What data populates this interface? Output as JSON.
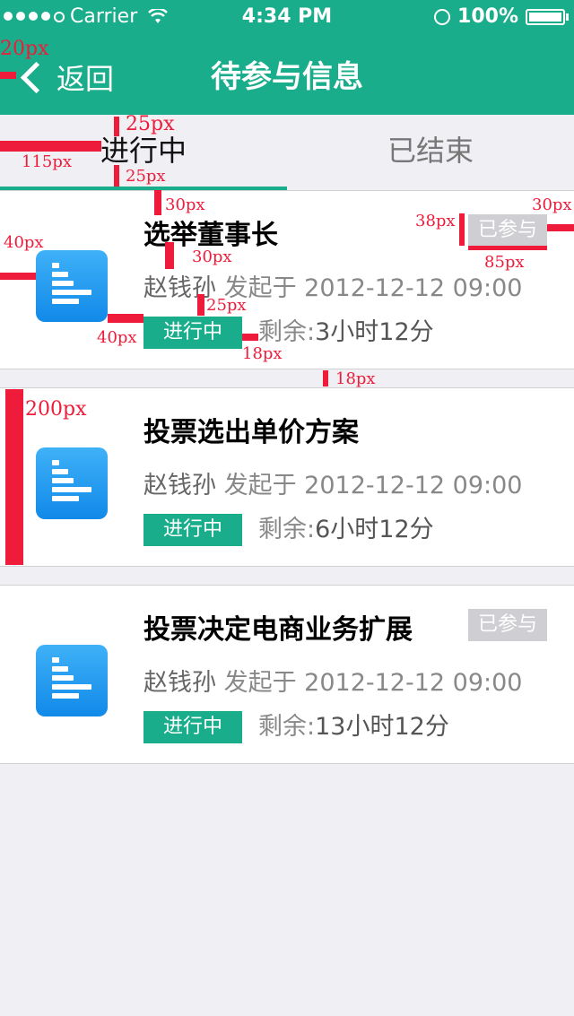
{
  "status": {
    "carrier": "Carrier",
    "time": "4:34 PM",
    "battery": "100%"
  },
  "nav": {
    "back_label": "返回",
    "title": "待参与信息"
  },
  "tabs": [
    {
      "label": "进行中"
    },
    {
      "label": "已结束"
    }
  ],
  "items": [
    {
      "title": "选举董事长",
      "author": "赵钱孙",
      "initiated": "发起于 2012-12-12  09:00",
      "status": "进行中",
      "remain_label": "剩余:",
      "remain_value": "3小时12分",
      "joined": "已参与"
    },
    {
      "title": "投票选出单价方案",
      "author": "赵钱孙",
      "initiated": "发起于 2012-12-12  09:00",
      "status": "进行中",
      "remain_label": "剩余:",
      "remain_value": "6小时12分",
      "joined": ""
    },
    {
      "title": "投票决定电商业务扩展",
      "author": "赵钱孙",
      "initiated": "发起于 2012-12-12  09:00",
      "status": "进行中",
      "remain_label": "剩余:",
      "remain_value": "13小时12分",
      "joined": "已参与"
    }
  ],
  "annotations": {
    "a20": "20px",
    "a25top": "25px",
    "a115": "115px",
    "a25bot": "25px",
    "a30a": "30px",
    "a38": "38px",
    "a30right": "30px",
    "a40left": "40px",
    "a85": "85px",
    "a30b": "30px",
    "a25c": "25px",
    "a40b": "40px",
    "a18a": "18px",
    "a18b": "18px",
    "a200": "200px"
  },
  "colors": {
    "brand": "#1aad8c",
    "icon_top": "#3fb1f8",
    "icon_bottom": "#1189e8",
    "annotation": "#ee1c3a"
  }
}
